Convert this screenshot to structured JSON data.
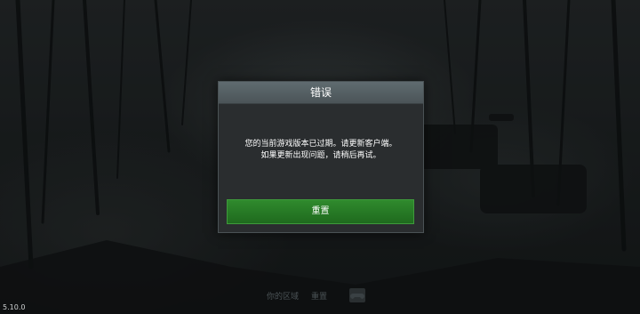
{
  "dialog": {
    "title": "错误",
    "message_line1": "您的当前游戏版本已过期。请更新客户端。",
    "message_line2": "如果更新出现问题，请稍后再试。",
    "button_label": "重置"
  },
  "bottom_bar": {
    "region_link": "你的区域",
    "reset_link": "重置",
    "icon": "controller-icon"
  },
  "version": "5.10.0",
  "colors": {
    "button_green": "#2a7d28",
    "header_gray": "#566166",
    "dialog_bg": "#2a2d2f"
  }
}
